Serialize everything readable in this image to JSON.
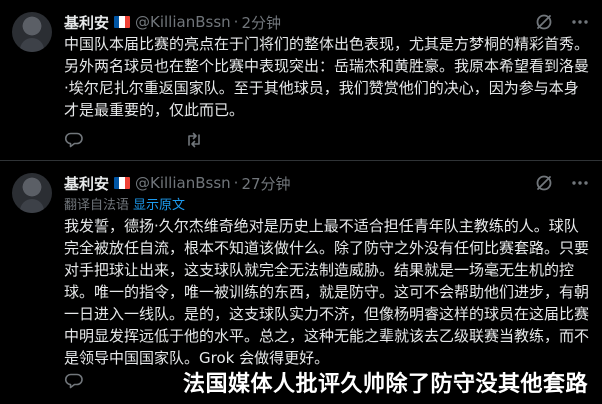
{
  "tweets": [
    {
      "author_name": "基利安",
      "flag": "france-flag",
      "handle": "@KillianBssn",
      "separator": "·",
      "time": "2分钟",
      "text": "中国队本届比赛的亮点在于门将们的整体出色表现，尤其是方梦桐的精彩首秀。另外两名球员也在整个比赛中表现突出：岳瑞杰和黄胜豪。我原本希望看到洛曼·埃尔尼扎尔重返国家队。至于其他球员，我们赞赏他们的决心，因为参与本身才是最重要的，仅此而已。"
    },
    {
      "author_name": "基利安",
      "flag": "france-flag",
      "handle": "@KillianBssn",
      "separator": "·",
      "time": "27分钟",
      "translated_label": "翻译自法语",
      "show_original": "显示原文",
      "text": "我发誓，德扬·久尔杰维奇绝对是历史上最不适合担任青年队主教练的人。球队完全被放任自流，根本不知道该做什么。除了防守之外没有任何比赛套路。只要对手把球让出来，这支球队就完全无法制造威胁。结果就是一场毫无生机的控球。唯一的指令，唯一被训练的东西，就是防守。这可不会帮助他们进步，有朝一日进入一线队。是的，这支球队实力不济，但像杨明睿这样的球员在这届比赛中明显发挥远低于他的水平。总之，这种无能之辈就该去乙级联赛当教练，而不是领导中国国家队。Grok 会做得更好。"
    }
  ],
  "caption": "法国媒体人批评久帅除了防守没其他套路",
  "colors": {
    "background": "#000000",
    "text": "#e7e9ea",
    "muted": "#71767b",
    "link": "#1d9bf0",
    "divider": "#2f3336"
  },
  "icons": [
    "grok-icon",
    "more-icon",
    "reply-icon",
    "repost-icon"
  ]
}
